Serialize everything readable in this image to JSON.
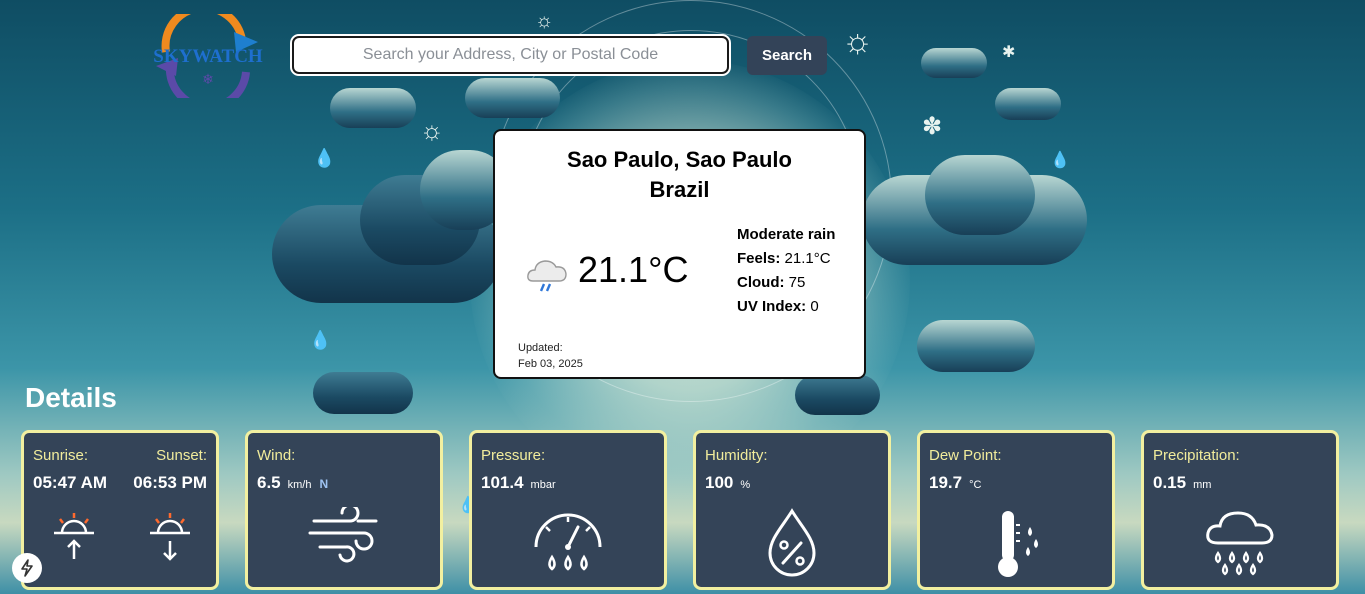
{
  "app": {
    "brand": "SKYWATCH"
  },
  "search": {
    "placeholder": "Search your Address, City or Postal Code",
    "value": "",
    "button_label": "Search"
  },
  "weather": {
    "city_line1": "Sao Paulo, Sao Paulo",
    "city_line2": "Brazil",
    "temperature": "21.1°C",
    "icon": "cloud-rain-icon",
    "condition": "Moderate rain",
    "feels_label": "Feels:",
    "feels_value": "21.1°C",
    "cloud_label": "Cloud:",
    "cloud_value": "75",
    "uv_label": "UV Index:",
    "uv_value": "0",
    "updated_label": "Updated:",
    "updated_date": "Feb 03, 2025"
  },
  "details": {
    "title": "Details",
    "sun": {
      "sunrise_label": "Sunrise:",
      "sunrise_value": "05:47 AM",
      "sunset_label": "Sunset:",
      "sunset_value": "06:53 PM"
    },
    "wind": {
      "label": "Wind:",
      "value": "6.5",
      "unit": "km/h",
      "direction": "N"
    },
    "pressure": {
      "label": "Pressure:",
      "value": "101.4",
      "unit": "mbar"
    },
    "humidity": {
      "label": "Humidity:",
      "value": "100",
      "unit": "%"
    },
    "dew_point": {
      "label": "Dew Point:",
      "value": "19.7",
      "unit": "°C"
    },
    "precipitation": {
      "label": "Precipitation:",
      "value": "0.15",
      "unit": "mm"
    }
  },
  "colors": {
    "card_bg": "#344458",
    "card_border": "#f2f0a0",
    "label_yellow": "#f1ec9c",
    "button_bg": "#334358"
  }
}
